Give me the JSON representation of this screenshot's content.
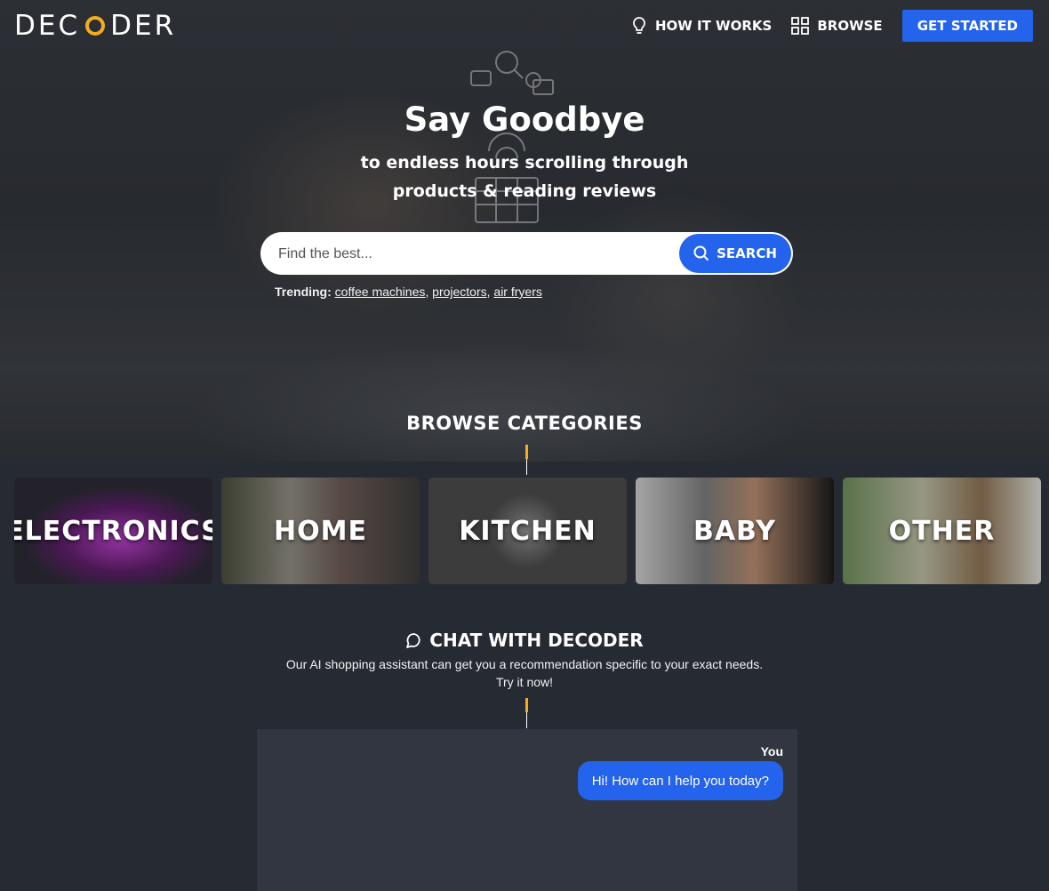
{
  "brand": {
    "logo_text_left": "DEC",
    "logo_text_right": "DER",
    "accent": "#f3ad1e",
    "primary": "#2463eb"
  },
  "nav": {
    "how_it_works": "HOW IT WORKS",
    "browse": "BROWSE",
    "get_started": "GET STARTED"
  },
  "hero": {
    "title": "Say Goodbye",
    "subtitle_line1": "to endless hours scrolling through",
    "subtitle_line2": "products & reading reviews",
    "search": {
      "placeholder": "Find the best...",
      "value": "",
      "button": "SEARCH"
    },
    "trending": {
      "label": "Trending:",
      "items": [
        "coffee machines",
        "projectors",
        "air fryers"
      ]
    }
  },
  "categories": {
    "title": "BROWSE CATEGORIES",
    "items": [
      "ELECTRONICS",
      "HOME",
      "KITCHEN",
      "BABY",
      "OTHER"
    ]
  },
  "chat": {
    "title": "CHAT WITH DECODER",
    "desc_line1": "Our AI shopping assistant can get you a recommendation specific to your exact needs.",
    "desc_line2": "Try it now!",
    "sender": "You",
    "message": "Hi! How can I help you today?"
  }
}
